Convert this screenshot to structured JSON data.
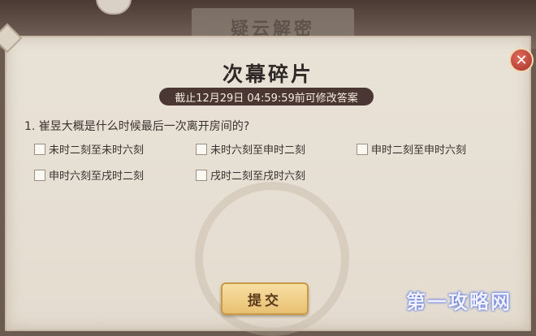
{
  "background": {
    "plaque_text": "疑云解密"
  },
  "dialog": {
    "title": "次幕碎片",
    "deadline": "截止12月29日 04:59:59前可修改答案",
    "question": "1. 崔昱大概是什么时候最后一次离开房间的?",
    "options": [
      {
        "label": "未时二刻至未时六刻",
        "checked": false
      },
      {
        "label": "未时六刻至申时二刻",
        "checked": false
      },
      {
        "label": "申时二刻至申时六刻",
        "checked": false
      },
      {
        "label": "申时六刻至戌时二刻",
        "checked": false
      },
      {
        "label": "戌时二刻至戌时六刻",
        "checked": false
      }
    ],
    "submit_label": "提交",
    "close_icon": "close-icon"
  },
  "watermark": {
    "text": "第一攻略网"
  },
  "colors": {
    "panel": "#e9e2d7",
    "banner": "#4a3733",
    "button": "#f0cf85",
    "close": "#c8483a"
  }
}
